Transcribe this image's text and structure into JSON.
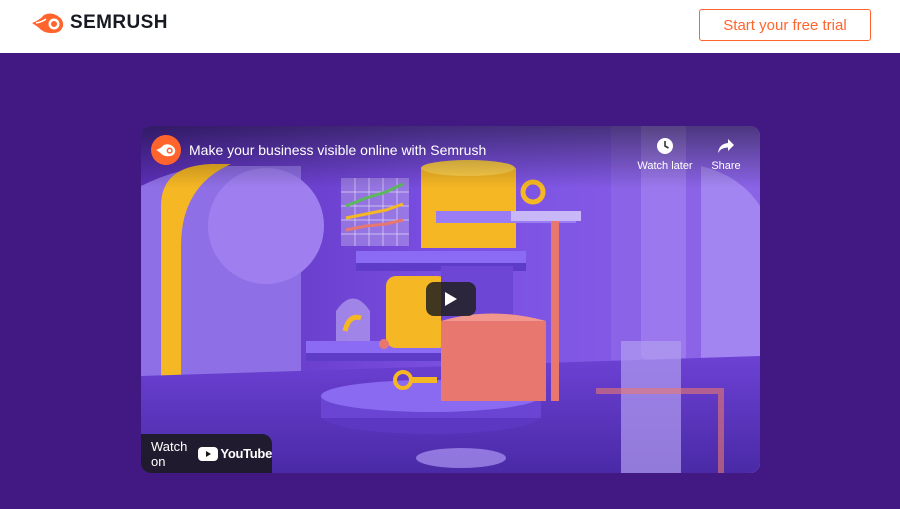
{
  "header": {
    "logo_text": "SEMRUSH",
    "cta_label": "Start your free trial"
  },
  "video": {
    "title": "Make your business visible online with Semrush",
    "watch_later_label": "Watch later",
    "share_label": "Share",
    "watch_on_label": "Watch on",
    "youtube_label": "YouTube"
  },
  "colors": {
    "brand_orange": "#ff642d",
    "page_background": "#421983",
    "scene_purple": "#7b4fe0",
    "cylinder_yellow": "#f5b724",
    "coral": "#e8786f"
  },
  "icons": [
    "semrush-logo-icon",
    "clock-icon",
    "share-arrow-icon",
    "play-icon",
    "youtube-icon"
  ]
}
